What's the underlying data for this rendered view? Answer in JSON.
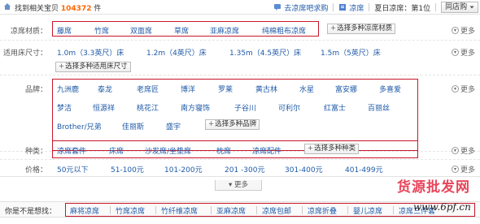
{
  "header": {
    "found_prefix": "找到相关宝贝",
    "found_count": "104372",
    "found_suffix": "件",
    "forum_link": "去凉席吧求购",
    "tag_link": "凉席",
    "rank_text": "夏日凉席：第1位",
    "store_button": "同店购"
  },
  "filters": {
    "material": {
      "label": "凉席材质：",
      "items": [
        "藤席",
        "竹席",
        "双面席",
        "草席",
        "亚麻凉席",
        "纯棉粗布凉席"
      ],
      "multi_button": "选择多种凉席材质",
      "more": "更多"
    },
    "size": {
      "label": "适用床尺寸：",
      "items": [
        "1.0m（3.3英尺）床",
        "1.2m（4英尺）床",
        "1.35m（4.5英尺）床",
        "1.5m（5英尺）床"
      ],
      "multi_button": "选择多种适用床尺寸",
      "more": "更多"
    },
    "brand": {
      "label": "品牌：",
      "items_row1": [
        "九洲鹿",
        "泰龙",
        "老席匠",
        "博洋",
        "罗莱",
        "黄古林",
        "水星",
        "富安娜",
        "多喜爱"
      ],
      "items_row2": [
        "梦洁",
        "恒源祥",
        "桃花江",
        "南方寝饰",
        "子谷川",
        "可利尔",
        "红富士",
        "百丽丝"
      ],
      "items_row3": [
        "Brother/兄弟",
        "佳丽斯",
        "盛宇"
      ],
      "multi_button": "选择多种品牌",
      "more": "更多"
    },
    "type": {
      "label": "种类：",
      "items": [
        "凉席套件",
        "床席",
        "沙发席/坐垫席",
        "枕席",
        "凉席配件"
      ],
      "multi_button": "选择多种种类",
      "more": "更多"
    },
    "price": {
      "label": "价格：",
      "items": [
        "50元以下",
        "51-100元",
        "101-200元",
        "201 -300元",
        "301-400元",
        "401-499元"
      ],
      "more": "更多"
    }
  },
  "more_toggle": "更多",
  "suggest": {
    "label": "你是不是想找：",
    "items": [
      "麻将凉席",
      "竹席凉席",
      "竹纤维凉席",
      "亚麻凉席",
      "凉席包邮",
      "凉席折叠",
      "婴儿凉席",
      "凉席三件套"
    ]
  },
  "watermark": {
    "title": "货源批发网",
    "url": "www.6pf.cn"
  },
  "colors": {
    "link": "#1f5aa8",
    "count": "#ff6600",
    "highlight_box": "#c8162a"
  }
}
